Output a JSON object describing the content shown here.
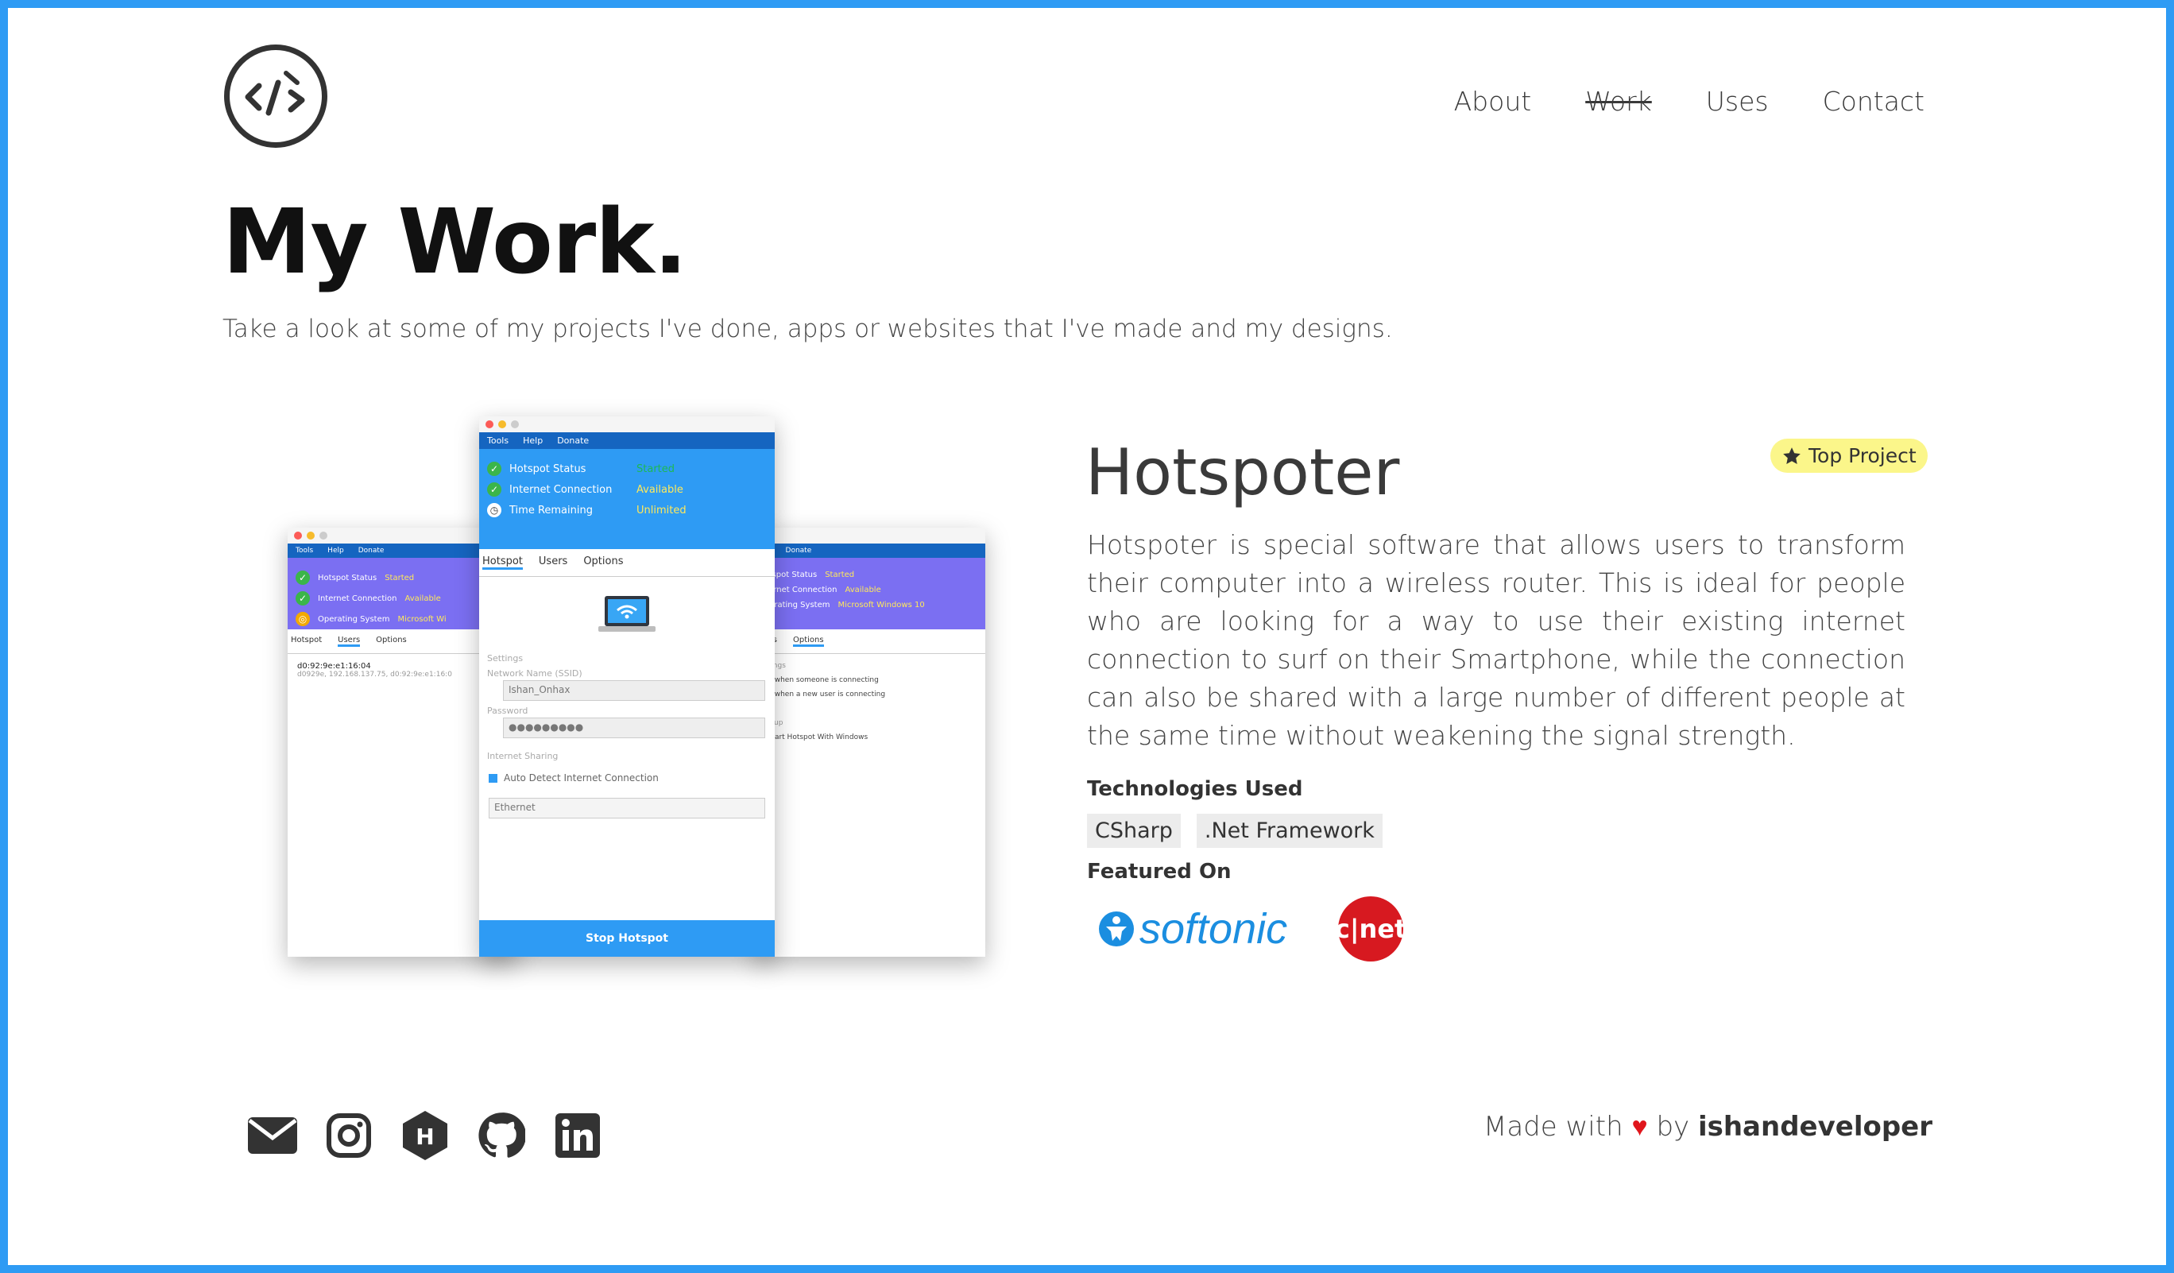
{
  "header": {
    "logo_icon": "code-brush-icon",
    "nav": [
      {
        "label": "About"
      },
      {
        "label": "Work",
        "active": true
      },
      {
        "label": "Uses"
      },
      {
        "label": "Contact"
      }
    ]
  },
  "page": {
    "title": "My Work.",
    "subtitle": "Take a look at some of my projects I've done, apps or websites that I've made and my designs."
  },
  "project": {
    "title": "Hotspoter",
    "badge": "Top Project",
    "description": "Hotspoter is special software that allows users to transform their computer into a wireless router. This is ideal for people who are looking for a way to use their existing internet connection to surf on their Smartphone, while the connection can also be shared with a large number of different people at the same time without weakening the signal strength.",
    "tech_label": "Technologies Used",
    "technologies": [
      "CSharp",
      ".Net Framework"
    ],
    "featured_label": "Featured On",
    "featured": [
      "softonic",
      "c|net"
    ]
  },
  "screenshot": {
    "menu": [
      "Tools",
      "Help",
      "Donate"
    ],
    "status": [
      {
        "label": "Hotspot Status",
        "value": "Started"
      },
      {
        "label": "Internet Connection",
        "value": "Available"
      },
      {
        "label": "Time Remaining",
        "value": "Unlimited"
      }
    ],
    "left_status": [
      {
        "label": "Hotspot Status",
        "value": "Started"
      },
      {
        "label": "Internet Connection",
        "value": "Available"
      },
      {
        "label": "Operating System",
        "value": "Microsoft Wi"
      }
    ],
    "right_status": [
      {
        "label": "Hotspot Status",
        "value": "Started"
      },
      {
        "label": "Internet Connection",
        "value": "Available"
      },
      {
        "label": "Operating System",
        "value": "Microsoft Windows 10"
      }
    ],
    "tabs": [
      "Hotspot",
      "Users",
      "Options"
    ],
    "device": "d0:92:9e:e1:16:04",
    "device_detail": "d0929e, 192.168.137.75, d0:92:9e:e1:16:0",
    "settings_label": "Settings",
    "ssid_label": "Network Name (SSID)",
    "ssid_value": "Ishan_Onhax",
    "password_label": "Password",
    "password_value": "●●●●●●●●●",
    "sharing_label": "Internet Sharing",
    "auto_detect": "Auto Detect Internet Connection",
    "adapter": "Ethernet",
    "stop_button": "Stop Hotspot",
    "opt1": "otify when someone is connecting",
    "opt2": "otify when a new user is connecting",
    "startup_label": "Startup",
    "opt3": "utostart Hotspot With Windows"
  },
  "footer": {
    "icons": [
      "mail-icon",
      "instagram-icon",
      "hashnode-icon",
      "github-icon",
      "linkedin-icon"
    ],
    "made_prefix": "Made with",
    "heart": "♥",
    "by": "by",
    "author": "ishandeveloper"
  },
  "colors": {
    "frame": "#2e9bf4",
    "badge": "#fbf68a",
    "heart": "#e0161c",
    "cnet": "#d71920",
    "softonic": "#1b8ee0"
  }
}
